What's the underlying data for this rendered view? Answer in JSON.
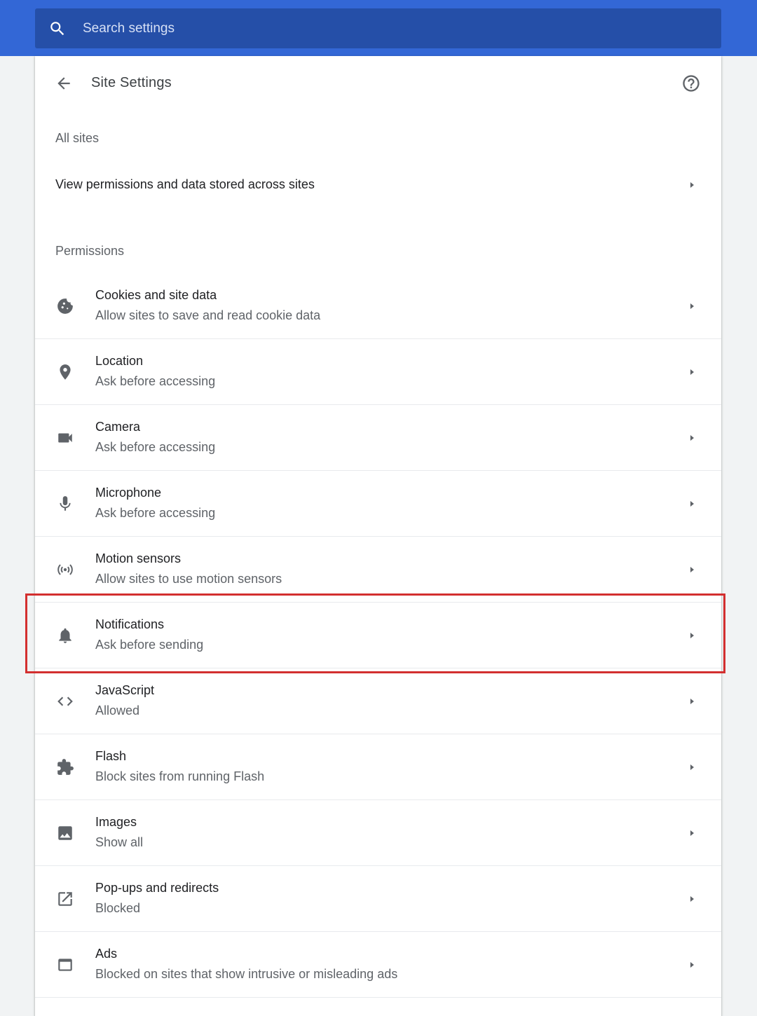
{
  "search": {
    "placeholder": "Search settings",
    "icon": "search-icon"
  },
  "header": {
    "title": "Site Settings",
    "back_icon": "arrow-back-icon",
    "help_icon": "help-circle-icon"
  },
  "all_sites": {
    "section_label": "All sites",
    "row_label": "View permissions and data stored across sites"
  },
  "permissions": {
    "section_label": "Permissions",
    "items": [
      {
        "title": "Cookies and site data",
        "subtitle": "Allow sites to save and read cookie data",
        "icon": "cookie-icon"
      },
      {
        "title": "Location",
        "subtitle": "Ask before accessing",
        "icon": "location-pin-icon"
      },
      {
        "title": "Camera",
        "subtitle": "Ask before accessing",
        "icon": "camera-icon"
      },
      {
        "title": "Microphone",
        "subtitle": "Ask before accessing",
        "icon": "microphone-icon"
      },
      {
        "title": "Motion sensors",
        "subtitle": "Allow sites to use motion sensors",
        "icon": "sensors-icon"
      },
      {
        "title": "Notifications",
        "subtitle": "Ask before sending",
        "icon": "bell-icon",
        "highlighted": true
      },
      {
        "title": "JavaScript",
        "subtitle": "Allowed",
        "icon": "code-icon"
      },
      {
        "title": "Flash",
        "subtitle": "Block sites from running Flash",
        "icon": "puzzle-icon"
      },
      {
        "title": "Images",
        "subtitle": "Show all",
        "icon": "image-icon"
      },
      {
        "title": "Pop-ups and redirects",
        "subtitle": "Blocked",
        "icon": "open-in-new-icon"
      },
      {
        "title": "Ads",
        "subtitle": "Blocked on sites that show intrusive or misleading ads",
        "icon": "web-asset-icon"
      }
    ]
  },
  "colors": {
    "topbar": "#3367d6",
    "searchbox": "#254fa8",
    "highlight": "#d32f2f",
    "icon": "#5f6368"
  }
}
